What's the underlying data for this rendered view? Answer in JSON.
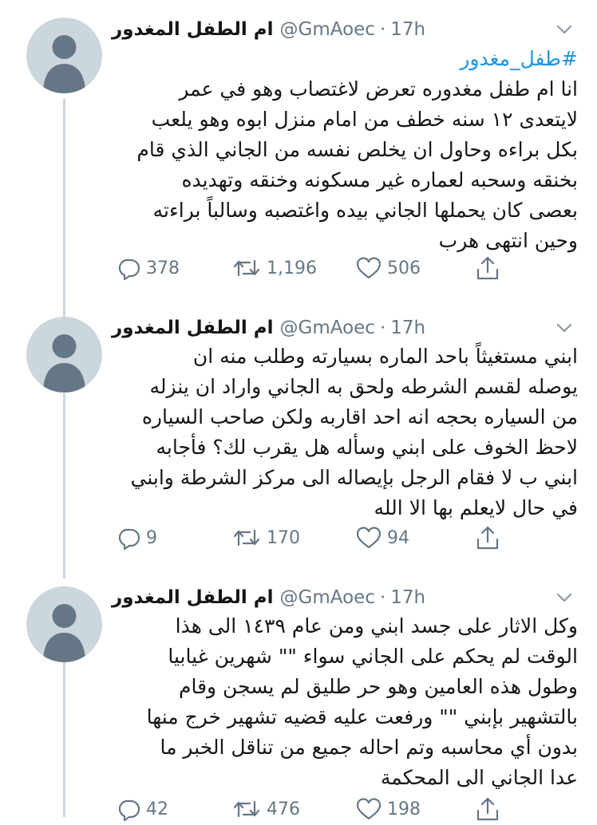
{
  "tweets": [
    {
      "display_name": "ام الطفل المغدور",
      "handle": "@GmAoec",
      "time": "17h",
      "hashtag": "#طفل_مغدور",
      "lines": [
        "انا ام طفل مغدوره تعرض لاغتصاب وهو في عمر",
        "لايتعدى ١٢ سنه خطف من امام منزل ابوه وهو يلعب",
        "بكل براءه وحاول ان يخلص نفسه من الجاني الذي قام",
        "بخنقه وسحبه لعماره غير مسكونه وخنقه وتهديده",
        "بعصى كان يحملها الجاني بيده واغتصبه وسالباً براءته",
        "وحين انتهى هرب"
      ],
      "replies": "378",
      "retweets": "1,196",
      "likes": "506"
    },
    {
      "display_name": "ام الطفل المغدور",
      "handle": "@GmAoec",
      "time": "17h",
      "lines": [
        "ابني مستغيثاً باحد الماره بسيارته وطلب منه ان",
        "يوصله لقسم الشرطه ولحق به الجاني واراد ان ينزله",
        "من السياره بحجه انه احد اقاربه ولكن صاحب السياره",
        "لاحظ الخوف على ابني وسأله هل يقرب لك؟ فأجابه",
        "ابني ب لا فقام الرجل بإيصاله الى مركز الشرطة وابني",
        "في حال لايعلم بها الا الله"
      ],
      "replies": "9",
      "retweets": "170",
      "likes": "94"
    },
    {
      "display_name": "ام الطفل المغدور",
      "handle": "@GmAoec",
      "time": "17h",
      "lines": [
        "وكل الاثار على جسد ابني ومن عام ١٤٣٩ الى هذا",
        "الوقت لم يحكم على الجاني سواء \"\" شهرين غيابيا",
        "وطول هذه العامين وهو حر طليق لم يسجن وقام",
        "بالتشهير بإبني \"\" ورفعت عليه قضيه تشهير خرج منها",
        "بدون أي محاسبه وتم احاله جميع من تناقل الخبر ما",
        "عدا الجاني الى المحكمة"
      ],
      "replies": "42",
      "retweets": "476",
      "likes": "198"
    }
  ],
  "icons": {
    "reply": "reply-icon",
    "retweet": "retweet-icon",
    "like": "heart-icon",
    "share": "share-icon",
    "menu": "chevron-down-icon",
    "avatar": "default-avatar-icon"
  },
  "colors": {
    "hashtag": "#1b95e0",
    "secondary_text": "#657786",
    "thread_line": "#ccd6dd",
    "avatar_bg": "#ccd6dd",
    "avatar_figure": "#657786"
  }
}
